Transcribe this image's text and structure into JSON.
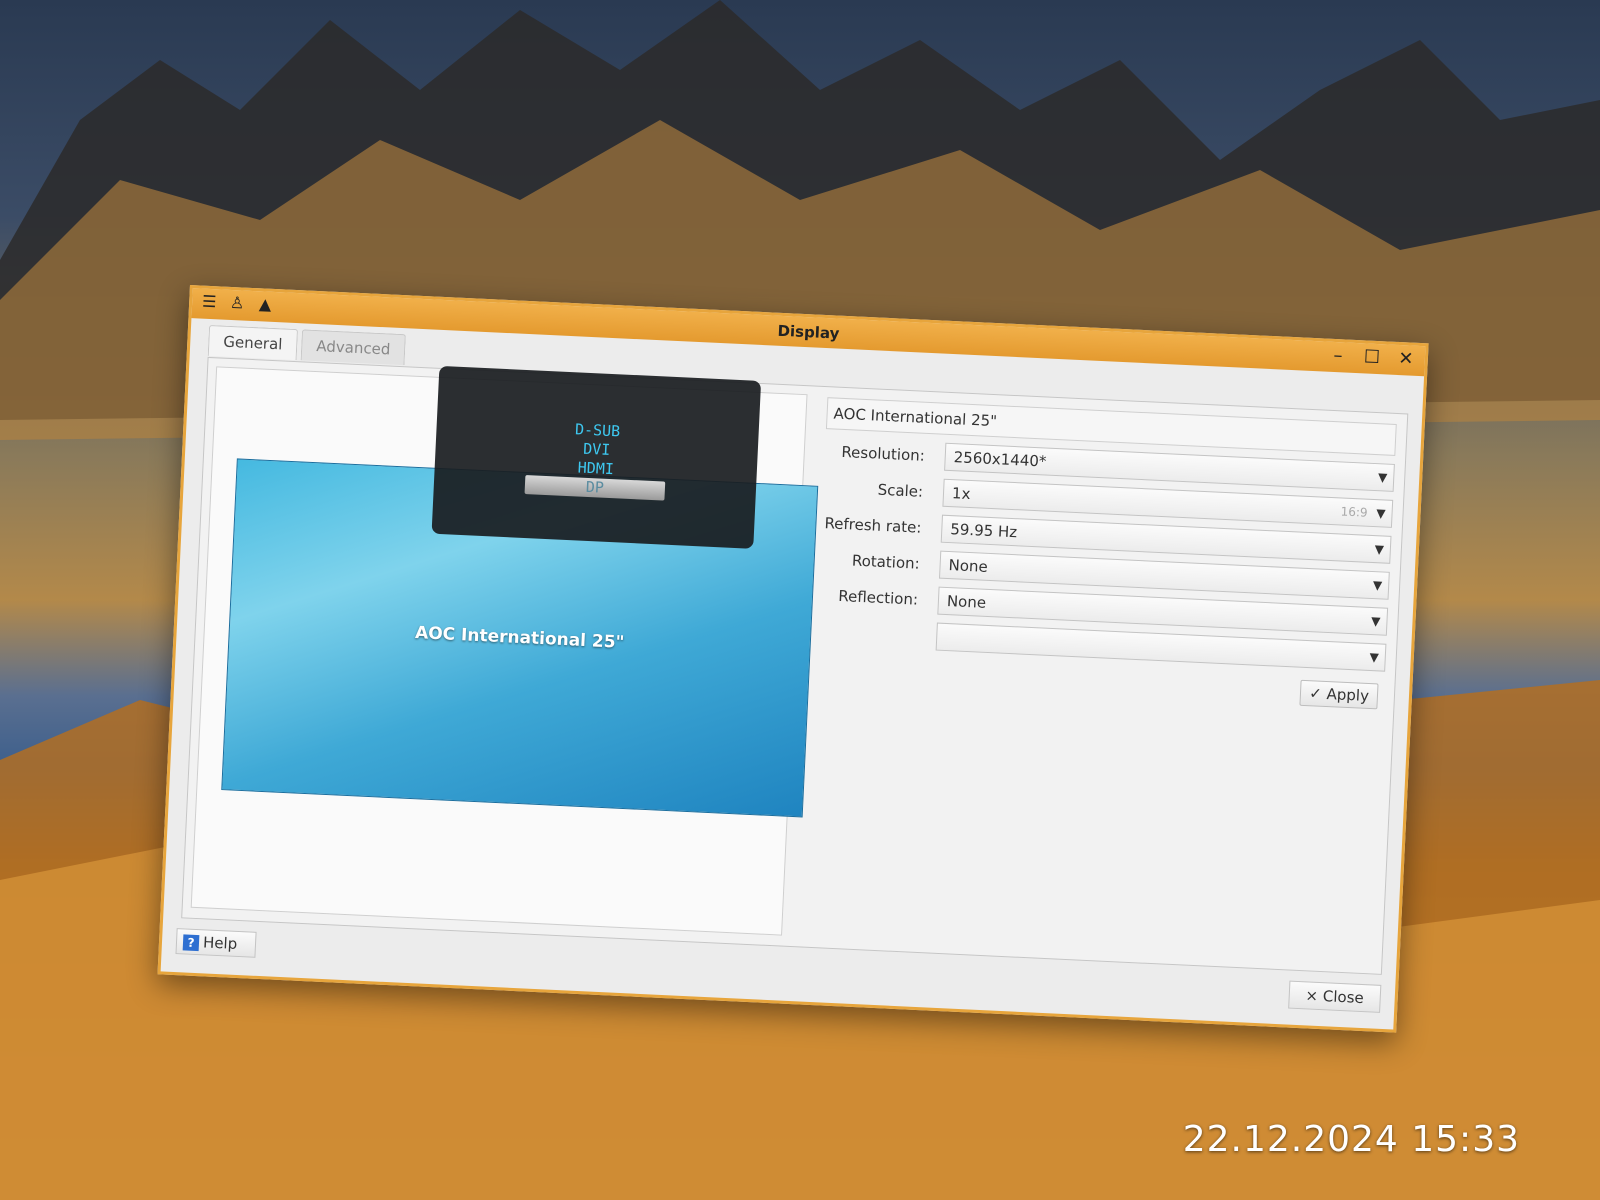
{
  "window": {
    "title": "Display",
    "menu_icon": "menu-icon",
    "pin_icon": "pin-icon",
    "up_icon": "up-icon"
  },
  "tabs": [
    {
      "label": "General",
      "active": true
    },
    {
      "label": "Advanced",
      "active": false
    }
  ],
  "preview": {
    "monitor_label": "AOC International 25\""
  },
  "osd": {
    "items": [
      "D-SUB",
      "DVI",
      "HDMI",
      "DP"
    ],
    "selected": "DP"
  },
  "settings": {
    "monitor_name": "AOC International 25\"",
    "resolution_label": "Resolution:",
    "resolution_value": "2560x1440*",
    "scale_label": "Scale:",
    "scale_value": "1x",
    "scale_hint": "16:9",
    "refresh_label": "Refresh rate:",
    "refresh_value": "59.95 Hz",
    "rotation_label": "Rotation:",
    "rotation_value": "None",
    "reflection_label": "Reflection:",
    "reflection_value": "None",
    "apply_label": "Apply"
  },
  "footer": {
    "help_label": "Help",
    "close_label": "Close"
  },
  "timestamp": "22.12.2024 15:33",
  "colors": {
    "titlebar": "#e7a53c",
    "osd_text": "#3ec8f0"
  }
}
